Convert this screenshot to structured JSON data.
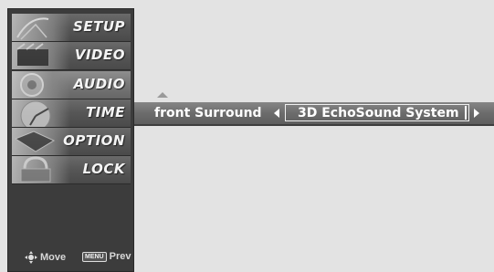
{
  "menu": {
    "items": [
      {
        "label": "SETUP",
        "icon": "satellite-dish-icon"
      },
      {
        "label": "VIDEO",
        "icon": "film-clapper-icon"
      },
      {
        "label": "AUDIO",
        "icon": "speaker-icon"
      },
      {
        "label": "TIME",
        "icon": "clock-icon"
      },
      {
        "label": "OPTION",
        "icon": "option-tag-icon"
      },
      {
        "label": "LOCK",
        "icon": "padlock-icon"
      }
    ],
    "active_index": 2
  },
  "footer": {
    "move_label": "Move",
    "menu_key_label": "MENU",
    "prev_label": "Prev"
  },
  "option": {
    "label": "front Surround",
    "value": "3D EchoSound System"
  },
  "colors": {
    "background": "#e3e3e3",
    "sidebar": "#3c3c3c",
    "bar": "#6c6c6c",
    "text": "#ffffff"
  }
}
